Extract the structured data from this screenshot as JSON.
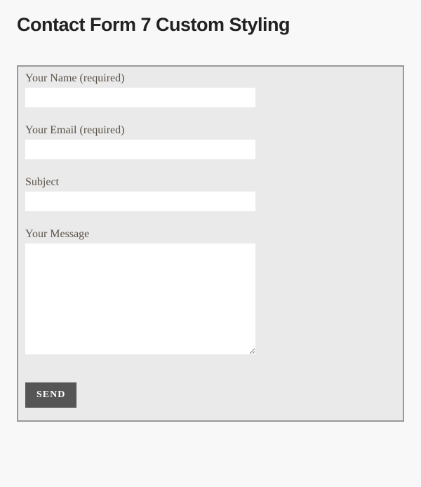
{
  "title": "Contact Form 7 Custom Styling",
  "form": {
    "name": {
      "label": "Your Name (required)",
      "value": ""
    },
    "email": {
      "label": "Your Email (required)",
      "value": ""
    },
    "subject": {
      "label": "Subject",
      "value": ""
    },
    "message": {
      "label": "Your Message",
      "value": ""
    },
    "submit_label": "SEND"
  }
}
